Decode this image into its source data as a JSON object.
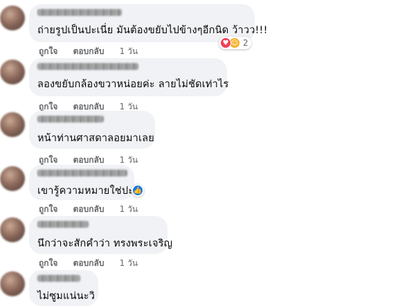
{
  "comments": [
    {
      "text": "ถ่ายรูปเป็นปะเนี่ย มันต้องขยับไปข้างๆอีกนิด ว้าวว!!!",
      "like_label": "ถูกใจ",
      "reply_label": "ตอบกลับ",
      "time": "1 วัน",
      "reactions": {
        "count": "2",
        "icons": [
          "love-icon",
          "haha-icon"
        ]
      }
    },
    {
      "text": "ลองขยับกล้องขวาหน่อยค่ะ ลายไม่ชัดเท่าไร",
      "like_label": "ถูกใจ",
      "reply_label": "ตอบกลับ",
      "time": "1 วัน"
    },
    {
      "text": "หน้าท่านศาสดาลอยมาเลย",
      "like_label": "ถูกใจ",
      "reply_label": "ตอบกลับ",
      "time": "1 วัน"
    },
    {
      "text": "เขารู้ความหมายใช่ปะ",
      "like_label": "ถูกใจ",
      "reply_label": "ตอบกลับ",
      "time": "1 วัน",
      "reactions": {
        "icons": [
          "like-icon"
        ]
      }
    },
    {
      "text": "นึกว่าจะสักคำว่า ทรงพระเจริญ",
      "like_label": "ถูกใจ",
      "reply_label": "ตอบกลับ",
      "time": "1 วัน"
    },
    {
      "text": "ไม่ซูมแน่นะวิ"
    }
  ],
  "colors": {
    "bubble": "#f0f2f5",
    "action_text": "#65676b",
    "love": "#f33e58",
    "haha": "#f7b125",
    "like": "#1877f2"
  }
}
